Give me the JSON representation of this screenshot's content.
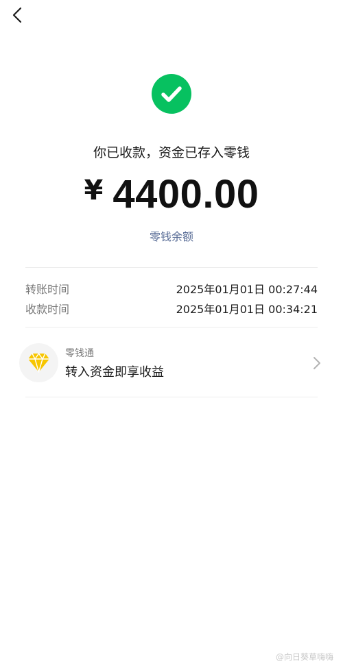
{
  "status": {
    "message": "你已收款，资金已存入零钱"
  },
  "amount": {
    "currency_symbol": "¥",
    "value": "4400.00"
  },
  "balance_link": "零钱余额",
  "details": [
    {
      "label": "转账时间",
      "value": "2025年01月01日 00:27:44"
    },
    {
      "label": "收款时间",
      "value": "2025年01月01日 00:34:21"
    }
  ],
  "promo": {
    "subtitle": "零钱通",
    "title": "转入资金即享收益",
    "icon": "diamond-icon"
  },
  "watermark": "@向日葵草嗨嗨",
  "icons": {
    "back": "chevron-left-icon",
    "success": "check-circle-icon",
    "chevron": "chevron-right-icon"
  },
  "colors": {
    "success_green": "#07c160",
    "link_blue": "#576b95",
    "diamond_yellow": "#f7c600"
  }
}
